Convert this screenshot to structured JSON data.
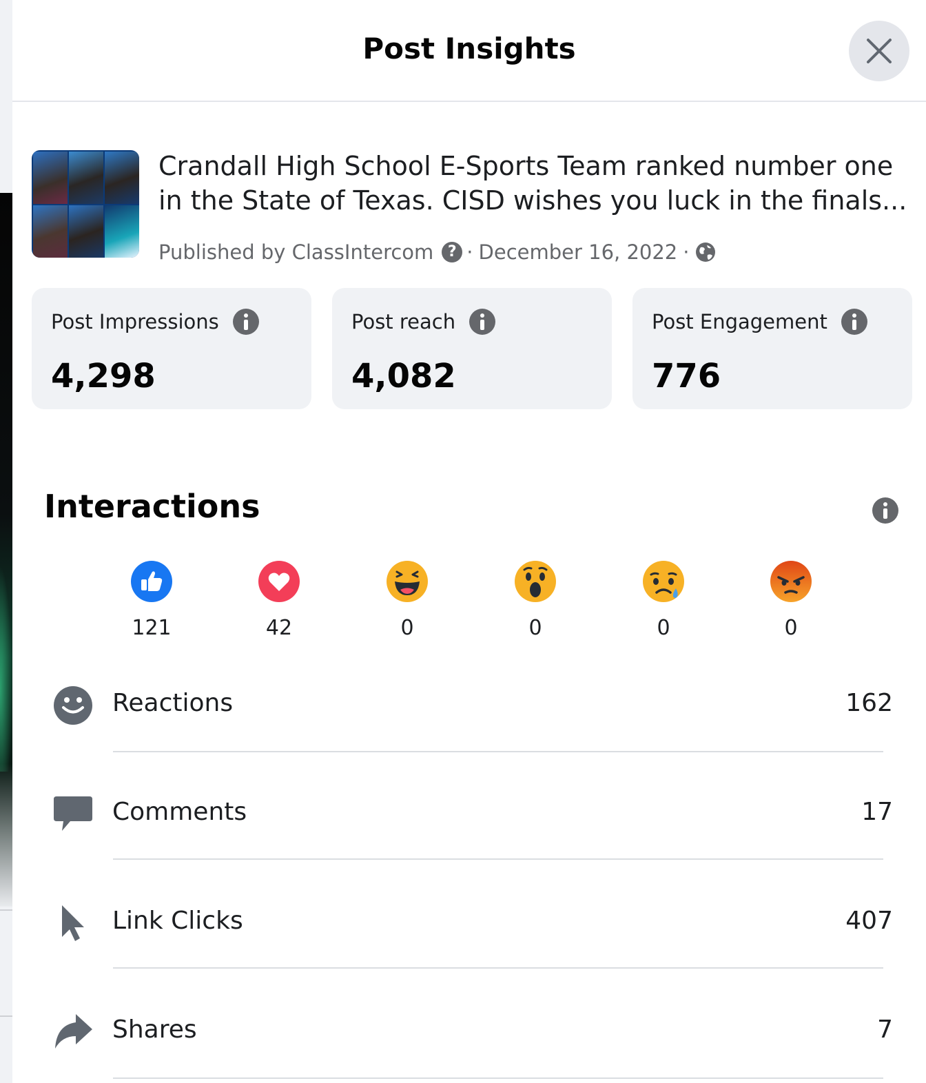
{
  "dialog": {
    "title": "Post Insights"
  },
  "post": {
    "text": "Crandall High School E-Sports Team ranked number one in the State of Texas. CISD wishes you luck in the finals...",
    "published_by": "Published by ClassIntercom",
    "separator": "·",
    "date": "December 16, 2022",
    "separator2": "·"
  },
  "stats": [
    {
      "label": "Post Impressions",
      "value": "4,298"
    },
    {
      "label": "Post reach",
      "value": "4,082"
    },
    {
      "label": "Post Engagement",
      "value": "776"
    }
  ],
  "interactions": {
    "title": "Interactions",
    "reactions": [
      {
        "type": "like",
        "icon": "like-icon",
        "count": "121",
        "color": "#1877f2"
      },
      {
        "type": "love",
        "icon": "love-icon",
        "count": "42",
        "color": "#f33e58"
      },
      {
        "type": "haha",
        "icon": "haha-icon",
        "count": "0",
        "color": "#f7b125"
      },
      {
        "type": "wow",
        "icon": "wow-icon",
        "count": "0",
        "color": "#f7b125"
      },
      {
        "type": "sad",
        "icon": "sad-icon",
        "count": "0",
        "color": "#f7b125"
      },
      {
        "type": "angry",
        "icon": "angry-icon",
        "count": "0",
        "color": "#e9710f"
      }
    ],
    "metrics": [
      {
        "label": "Reactions",
        "value": "162",
        "icon": "smiley-icon"
      },
      {
        "label": "Comments",
        "value": "17",
        "icon": "comment-icon"
      },
      {
        "label": "Link Clicks",
        "value": "407",
        "icon": "cursor-icon"
      },
      {
        "label": "Shares",
        "value": "7",
        "icon": "share-icon"
      }
    ]
  }
}
